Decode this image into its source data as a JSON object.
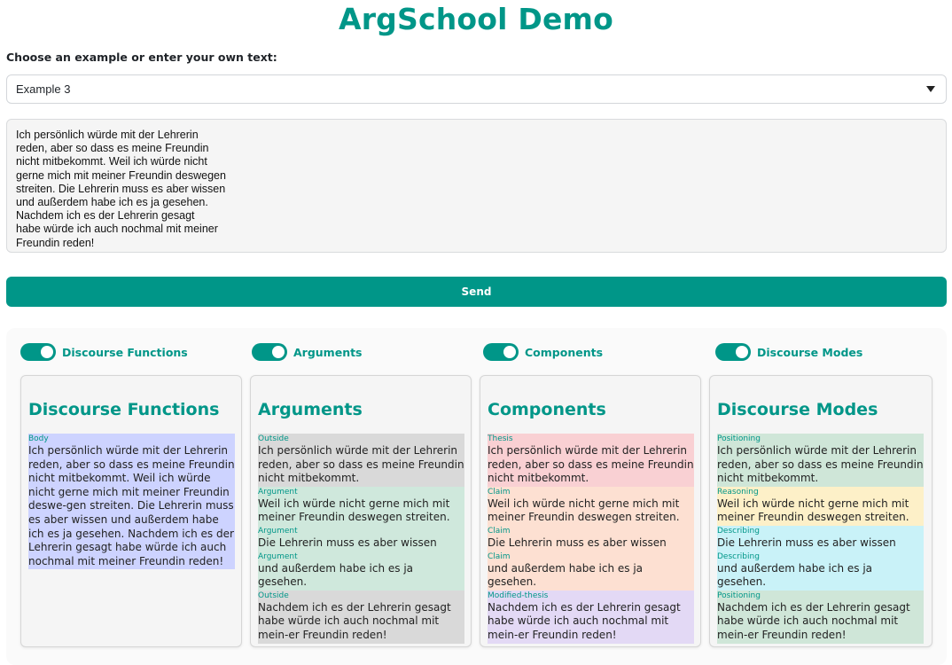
{
  "app": {
    "title": "ArgSchool Demo",
    "prompt_label": "Choose an example or enter your own text:",
    "selected_example": "Example 3",
    "input_text": "Ich persönlich würde mit der Lehrerin\nreden, aber so dass es meine Freundin\nnicht mitbekommt. Weil ich würde nicht\ngerne mich mit meiner Freundin deswegen\nstreiten. Die Lehrerin muss es aber wissen\nund außerdem habe ich es ja gesehen.\nNachdem ich es der Lehrerin gesagt\nhabe würde ich auch nochmal mit meiner\nFreundin reden!",
    "send_label": "Send"
  },
  "colors": {
    "accent": "#009688",
    "body": "#cdd3ff",
    "outside": "#d9d9d9",
    "argument": "#cfe8dc",
    "thesis": "#f9d0d3",
    "claim": "#fde0d2",
    "modified_thesis": "#e3d9f5",
    "positioning": "#cfe6d8",
    "reasoning": "#fdf0c8",
    "describing": "#c9f2f8"
  },
  "toggles": [
    {
      "label": "Discourse Functions",
      "on": true
    },
    {
      "label": "Arguments",
      "on": true
    },
    {
      "label": "Components",
      "on": true
    },
    {
      "label": "Discourse Modes",
      "on": true
    }
  ],
  "cards": [
    {
      "title": "Discourse Functions",
      "segments": [
        {
          "label": "Body",
          "color": "#cdd3ff",
          "text": "Ich persönlich würde mit der Lehrerin reden, aber so dass es meine Freundin nicht mitbekommt. Weil ich würde nicht gerne mich mit meiner Freundin deswe-gen streiten. Die Lehrerin muss es aber wissen und außerdem habe ich es ja gesehen. Nachdem ich es der Lehrerin gesagt habe würde ich auch nochmal mit meiner Freundin reden!"
        }
      ]
    },
    {
      "title": "Arguments",
      "segments": [
        {
          "label": "Outside",
          "color": "#d9d9d9",
          "text": "Ich persönlich würde mit der Lehrerin reden, aber so dass es meine Freundin nicht mitbekommt."
        },
        {
          "label": "Argument",
          "color": "#cfe8dc",
          "text": "Weil ich würde nicht gerne mich mit meiner Freundin deswegen streiten."
        },
        {
          "label": "Argument",
          "color": "#cfe8dc",
          "text": "Die Lehrerin muss es aber wissen"
        },
        {
          "label": "Argument",
          "color": "#cfe8dc",
          "text": "und außerdem habe ich es ja gesehen."
        },
        {
          "label": "Outside",
          "color": "#d9d9d9",
          "text": "Nachdem ich es der Lehrerin gesagt habe würde ich auch nochmal mit mein-er Freundin reden!"
        }
      ]
    },
    {
      "title": "Components",
      "segments": [
        {
          "label": "Thesis",
          "color": "#f9d0d3",
          "text": "Ich persönlich würde mit der Lehrerin reden, aber so dass es meine Freundin nicht mitbekommt."
        },
        {
          "label": "Claim",
          "color": "#fde0d2",
          "text": "Weil ich würde nicht gerne mich mit meiner Freundin deswegen streiten."
        },
        {
          "label": "Claim",
          "color": "#fde0d2",
          "text": "Die Lehrerin muss es aber wissen"
        },
        {
          "label": "Claim",
          "color": "#fde0d2",
          "text": "und außerdem habe ich es ja gesehen."
        },
        {
          "label": "Modified-thesis",
          "color": "#e3d9f5",
          "text": "Nachdem ich es der Lehrerin gesagt habe würde ich auch nochmal mit mein-er Freundin reden!"
        }
      ]
    },
    {
      "title": "Discourse Modes",
      "segments": [
        {
          "label": "Positioning",
          "color": "#cfe6d8",
          "text": "Ich persönlich würde mit der Lehrerin reden, aber so dass es meine Freundin nicht mitbekommt."
        },
        {
          "label": "Reasoning",
          "color": "#fdf0c8",
          "text": "Weil ich würde nicht gerne mich mit meiner Freundin deswegen streiten."
        },
        {
          "label": "Describing",
          "color": "#c9f2f8",
          "text": "Die Lehrerin muss es aber wissen"
        },
        {
          "label": "Describing",
          "color": "#c9f2f8",
          "text": "und außerdem habe ich es ja gesehen."
        },
        {
          "label": "Positioning",
          "color": "#cfe6d8",
          "text": "Nachdem ich es der Lehrerin gesagt habe würde ich auch nochmal mit mein-er Freundin reden!"
        }
      ]
    }
  ]
}
